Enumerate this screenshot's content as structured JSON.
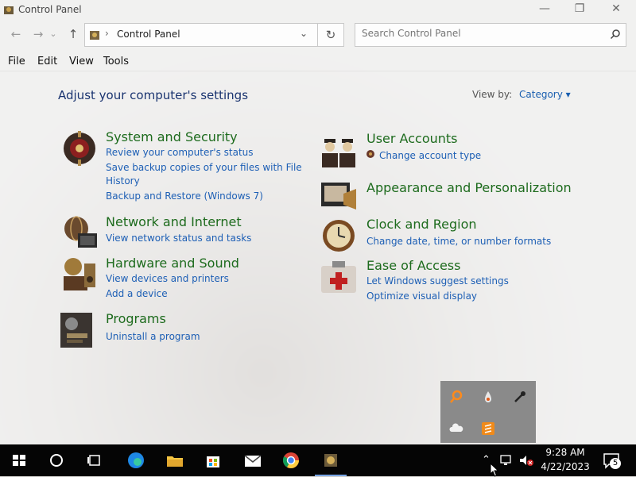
{
  "window": {
    "title": "Control Panel",
    "minimize": "—",
    "maximize": "❐",
    "close": "✕"
  },
  "nav": {
    "back": "←",
    "forward": "→",
    "recent": "⌄",
    "up": "↑"
  },
  "address": {
    "separator": "›",
    "path": "Control Panel",
    "dropdown": "⌄",
    "refresh": "↻"
  },
  "search": {
    "placeholder": "Search Control Panel"
  },
  "menu": {
    "file": "File",
    "edit": "Edit",
    "view": "View",
    "tools": "Tools"
  },
  "content": {
    "heading": "Adjust your computer's settings",
    "view_by_label": "View by:",
    "view_by_value": "Category ▾"
  },
  "categories": {
    "system": {
      "title": "System and Security",
      "links": [
        "Review your computer's status",
        "Save backup copies of your files with File",
        "History",
        "Backup and Restore (Windows 7)"
      ]
    },
    "network": {
      "title": "Network and Internet",
      "links": [
        "View network status and tasks"
      ]
    },
    "hardware": {
      "title": "Hardware and Sound",
      "links": [
        "View devices and printers",
        "Add a device"
      ]
    },
    "programs": {
      "title": "Programs",
      "links": [
        "Uninstall a program"
      ]
    },
    "users": {
      "title": "User Accounts",
      "links": [
        "Change account type"
      ]
    },
    "appearance": {
      "title": "Appearance and Personalization",
      "links": []
    },
    "clock": {
      "title": "Clock and Region",
      "links": [
        "Change date, time, or number formats"
      ]
    },
    "ease": {
      "title": "Ease of Access",
      "links": [
        "Let Windows suggest settings",
        "Optimize visual display"
      ]
    }
  },
  "taskbar": {
    "time": "9:28 AM",
    "date": "4/22/2023",
    "notification_count": "5"
  },
  "colors": {
    "title_green": "#1d6b1d",
    "link_blue": "#1d5fb5",
    "heading_navy": "#1a3470",
    "taskbar": "#050505"
  }
}
